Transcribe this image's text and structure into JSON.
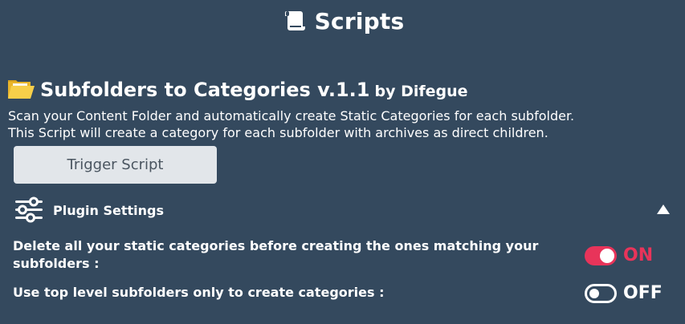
{
  "header": {
    "icon": "scroll-icon",
    "title": "Scripts"
  },
  "plugin": {
    "icon": "folder-icon",
    "name": "Subfolders to Categories v.1.1",
    "author": "by Difegue",
    "description_line_1": "Scan your Content Folder and automatically create Static Categories for each subfolder.",
    "description_line_2": "This Script will create a category for each subfolder with archives as direct children.",
    "trigger_label": "Trigger Script"
  },
  "settings": {
    "icon": "sliders-icon",
    "label": "Plugin Settings",
    "collapse_icon": "triangle-up-icon",
    "items": [
      {
        "label": "Delete all your static categories before creating the ones matching your subfolders :",
        "state": "ON",
        "enabled": true
      },
      {
        "label": "Use top level subfolders only to create categories :",
        "state": "OFF",
        "enabled": false
      }
    ]
  },
  "colors": {
    "background": "#34495e",
    "accent_on": "#e8345a",
    "button_bg": "#e2e6ea",
    "button_text": "#4a5560"
  }
}
